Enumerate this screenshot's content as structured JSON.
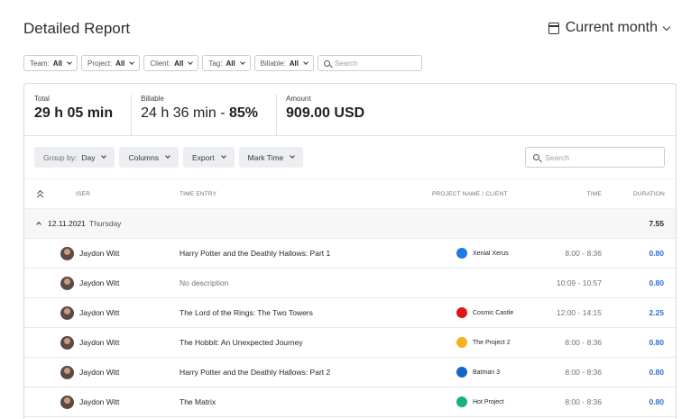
{
  "header": {
    "title": "Detailed Report",
    "period": "Current month"
  },
  "filters": [
    {
      "label": "Team:",
      "value": "All"
    },
    {
      "label": "Project:",
      "value": "All"
    },
    {
      "label": "Client:",
      "value": "All"
    },
    {
      "label": "Tag:",
      "value": "All"
    },
    {
      "label": "Billable:",
      "value": "All"
    }
  ],
  "filter_search_placeholder": "Search",
  "totals": {
    "total_label": "Total",
    "total_value": "29 h 05 min",
    "billable_label": "Billable",
    "billable_value": "24 h 36 min - ",
    "billable_pct": "85%",
    "amount_label": "Amount",
    "amount_value": "909.00 USD"
  },
  "toolbar": {
    "group_by_label": "Group by:",
    "group_by_value": "Day",
    "columns": "Columns",
    "export": "Export",
    "mark_time": "Mark Time",
    "search_placeholder": "Search"
  },
  "columns": {
    "user": "ISER",
    "entry": "TIME ENTRY",
    "project": "PROJECT NAME / CLIENT",
    "time": "TIME",
    "duration": "DURATION"
  },
  "group": {
    "date": "12.11.2021",
    "weekday": "Thursday",
    "total": "7.55"
  },
  "rows": [
    {
      "user": "Jaydon Witt",
      "entry": "Harry Potter and the Deathly Hallows: Part 1",
      "project": "Xenial Xerus",
      "color": "#1f7be0",
      "time": "8:00 - 8:36",
      "duration": "0.80"
    },
    {
      "user": "Jaydon Witt",
      "entry": "No description",
      "project": "",
      "color": "",
      "time": "10:09 - 10:57",
      "duration": "0.80"
    },
    {
      "user": "Jaydon Witt",
      "entry": "The Lord of the Rings: The Two Towers",
      "project": "Cosmic Castle",
      "color": "#e01515",
      "time": "12:00 - 14:15",
      "duration": "2.25"
    },
    {
      "user": "Jaydon Witt",
      "entry": "The Hobbit: An Unexpected Journey",
      "project": "The Project 2",
      "color": "#f5b21c",
      "time": "8:00 - 8:36",
      "duration": "0.80"
    },
    {
      "user": "Jaydon Witt",
      "entry": "Harry Potter and the Deathly Hallows: Part 2",
      "project": "Batman 3",
      "color": "#1565c9",
      "time": "8:00 - 8:36",
      "duration": "0.80"
    },
    {
      "user": "Jaydon Witt",
      "entry": "The Matrix",
      "project": "Hot Project",
      "color": "#16b37c",
      "time": "8:00 - 8:36",
      "duration": "0.80"
    }
  ]
}
